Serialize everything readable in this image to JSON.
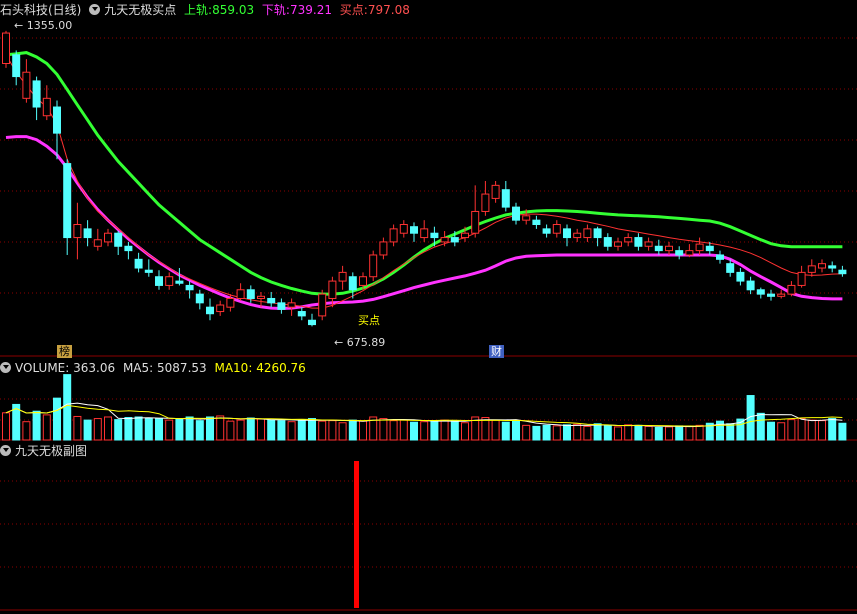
{
  "main_header": {
    "stock": "石头科技(日线)",
    "indicator": "九天无极买点",
    "upper_label": "上轨:",
    "upper_value": "859.03",
    "lower_label": "下轨:",
    "lower_value": "739.21",
    "buy_label": "买点:",
    "buy_value": "797.08"
  },
  "volume_header": {
    "label": "VOLUME:",
    "value": "363.06",
    "ma5_label": "MA5:",
    "ma5_value": "5087.53",
    "ma10_label": "MA10:",
    "ma10_value": "4260.76"
  },
  "sub_header": {
    "label": "九天无极副图"
  },
  "annotations": {
    "high_label": "1355.00",
    "low_label": "675.89",
    "buy_point_label": "买点",
    "tag_bang": "榜",
    "tag_cai": "财"
  },
  "colors": {
    "up": "#ff3232",
    "down": "#54ffff",
    "upper_band": "#33ff33",
    "lower_band": "#ff33ff",
    "ma_line": "#ff3232",
    "vol_ma5": "#ffffff",
    "vol_ma10": "#ffff00",
    "grid": "#8b0000",
    "buy_label": "#ffff00",
    "upper_label": "#33ff33",
    "lower_label": "#ff33ff",
    "buy_value": "#ff5050"
  },
  "chart_data": {
    "type": "candlestick",
    "y_range": [
      640,
      1380
    ],
    "candles": [
      [
        1280,
        1350,
        1355,
        1270
      ],
      [
        1300,
        1250,
        1310,
        1230
      ],
      [
        1200,
        1260,
        1290,
        1190
      ],
      [
        1240,
        1180,
        1250,
        1150
      ],
      [
        1160,
        1200,
        1230,
        1150
      ],
      [
        1180,
        1120,
        1195,
        1060
      ],
      [
        1050,
        880,
        1060,
        840
      ],
      [
        880,
        910,
        960,
        830
      ],
      [
        900,
        880,
        920,
        860
      ],
      [
        860,
        875,
        900,
        850
      ],
      [
        870,
        890,
        900,
        860
      ],
      [
        890,
        860,
        895,
        840
      ],
      [
        860,
        850,
        870,
        830
      ],
      [
        830,
        810,
        845,
        800
      ],
      [
        805,
        800,
        830,
        790
      ],
      [
        790,
        770,
        805,
        760
      ],
      [
        770,
        790,
        800,
        760
      ],
      [
        780,
        775,
        810,
        770
      ],
      [
        770,
        760,
        780,
        740
      ],
      [
        750,
        730,
        760,
        715
      ],
      [
        720,
        705,
        740,
        690
      ],
      [
        710,
        725,
        735,
        700
      ],
      [
        720,
        740,
        750,
        710
      ],
      [
        740,
        760,
        775,
        735
      ],
      [
        760,
        740,
        770,
        730
      ],
      [
        740,
        745,
        755,
        720
      ],
      [
        740,
        730,
        755,
        720
      ],
      [
        730,
        715,
        740,
        705
      ],
      [
        720,
        730,
        740,
        700
      ],
      [
        710,
        700,
        720,
        690
      ],
      [
        690,
        680,
        705,
        676
      ],
      [
        700,
        750,
        760,
        690
      ],
      [
        740,
        780,
        790,
        720
      ],
      [
        780,
        800,
        815,
        760
      ],
      [
        790,
        760,
        800,
        740
      ],
      [
        770,
        790,
        800,
        760
      ],
      [
        790,
        840,
        850,
        780
      ],
      [
        840,
        870,
        880,
        830
      ],
      [
        870,
        900,
        910,
        860
      ],
      [
        890,
        910,
        920,
        880
      ],
      [
        905,
        890,
        915,
        870
      ],
      [
        880,
        900,
        920,
        870
      ],
      [
        890,
        880,
        905,
        860
      ],
      [
        870,
        880,
        895,
        860
      ],
      [
        880,
        870,
        895,
        860
      ],
      [
        880,
        890,
        905,
        870
      ],
      [
        890,
        940,
        1000,
        880
      ],
      [
        940,
        980,
        1010,
        930
      ],
      [
        970,
        1000,
        1010,
        960
      ],
      [
        990,
        950,
        1010,
        940
      ],
      [
        950,
        920,
        960,
        910
      ],
      [
        920,
        930,
        945,
        910
      ],
      [
        920,
        910,
        930,
        900
      ],
      [
        900,
        890,
        910,
        880
      ],
      [
        890,
        910,
        920,
        880
      ],
      [
        900,
        880,
        910,
        860
      ],
      [
        880,
        890,
        900,
        870
      ],
      [
        880,
        900,
        910,
        870
      ],
      [
        900,
        880,
        905,
        860
      ],
      [
        880,
        860,
        890,
        850
      ],
      [
        860,
        870,
        880,
        850
      ],
      [
        870,
        880,
        890,
        860
      ],
      [
        880,
        860,
        890,
        850
      ],
      [
        860,
        870,
        880,
        850
      ],
      [
        860,
        850,
        875,
        840
      ],
      [
        850,
        860,
        870,
        840
      ],
      [
        850,
        840,
        860,
        830
      ],
      [
        840,
        850,
        865,
        835
      ],
      [
        850,
        865,
        880,
        840
      ],
      [
        860,
        850,
        870,
        840
      ],
      [
        840,
        830,
        850,
        820
      ],
      [
        820,
        800,
        830,
        790
      ],
      [
        800,
        780,
        810,
        770
      ],
      [
        780,
        760,
        790,
        750
      ],
      [
        760,
        750,
        765,
        740
      ],
      [
        750,
        745,
        760,
        735
      ],
      [
        745,
        750,
        760,
        740
      ],
      [
        750,
        770,
        780,
        745
      ],
      [
        770,
        800,
        815,
        765
      ],
      [
        800,
        815,
        830,
        790
      ],
      [
        810,
        820,
        830,
        800
      ],
      [
        815,
        810,
        825,
        800
      ],
      [
        805,
        797,
        815,
        790
      ]
    ],
    "upper_band": [
      1300,
      1302,
      1305,
      1295,
      1280,
      1255,
      1220,
      1185,
      1150,
      1115,
      1085,
      1055,
      1030,
      1005,
      980,
      955,
      935,
      915,
      895,
      875,
      860,
      845,
      830,
      815,
      800,
      788,
      778,
      770,
      763,
      757,
      752,
      750,
      750,
      752,
      757,
      764,
      773,
      785,
      800,
      817,
      835,
      852,
      866,
      878,
      888,
      898,
      908,
      917,
      925,
      932,
      936,
      939,
      941,
      942,
      942,
      941,
      940,
      938,
      936,
      934,
      932,
      931,
      930,
      929,
      928,
      926,
      924,
      922,
      920,
      918,
      913,
      905,
      895,
      885,
      875,
      866,
      861,
      859,
      859,
      859,
      859,
      859,
      859
    ],
    "lower_band": [
      1110,
      1112,
      1112,
      1105,
      1090,
      1070,
      1040,
      1005,
      972,
      944,
      920,
      898,
      877,
      858,
      840,
      823,
      808,
      794,
      782,
      770,
      760,
      750,
      741,
      733,
      726,
      721,
      718,
      717,
      718,
      721,
      725,
      728,
      730,
      731,
      732,
      734,
      738,
      744,
      751,
      758,
      765,
      771,
      777,
      782,
      787,
      792,
      798,
      805,
      815,
      826,
      833,
      837,
      838,
      839,
      840,
      840,
      840,
      840,
      840,
      840,
      840,
      840,
      840,
      840,
      840,
      840,
      840,
      840,
      840,
      840,
      838,
      830,
      818,
      803,
      790,
      778,
      765,
      752,
      745,
      742,
      740,
      739,
      739
    ],
    "ma_line": [
      1300,
      1260,
      1230,
      1200,
      1180,
      1140,
      1060,
      1010,
      970,
      940,
      920,
      900,
      880,
      860,
      840,
      825,
      810,
      795,
      785,
      775,
      765,
      756,
      748,
      742,
      737,
      733,
      730,
      727,
      725,
      722,
      718,
      718,
      724,
      735,
      746,
      758,
      772,
      788,
      804,
      819,
      834,
      847,
      858,
      866,
      873,
      880,
      890,
      902,
      915,
      925,
      931,
      934,
      934,
      932,
      929,
      925,
      920,
      916,
      911,
      906,
      900,
      896,
      892,
      888,
      884,
      880,
      876,
      873,
      870,
      867,
      863,
      858,
      852,
      844,
      834,
      822,
      810,
      800,
      795,
      793,
      794,
      796,
      797
    ],
    "volume": {
      "ma5_line": "white",
      "ma10_line": "yellow",
      "bars": [
        5200,
        6800,
        3500,
        5500,
        4800,
        8000,
        12500,
        4500,
        3800,
        4100,
        4400,
        3900,
        4300,
        4400,
        4200,
        4100,
        3800,
        4000,
        4400,
        3700,
        4400,
        4600,
        3600,
        3800,
        4200,
        4000,
        3800,
        3700,
        3500,
        3900,
        4100,
        3600,
        3700,
        3300,
        3800,
        3600,
        4400,
        4100,
        3700,
        3800,
        3400,
        3500,
        3700,
        3800,
        3600,
        3300,
        4400,
        4300,
        3800,
        3400,
        3600,
        2800,
        2600,
        2800,
        2700,
        2900,
        3000,
        2600,
        3100,
        2700,
        2500,
        2900,
        2800,
        2600,
        2400,
        2500,
        2700,
        2600,
        2800,
        3200,
        3600,
        3100,
        4000,
        8500,
        5100,
        3400,
        3300,
        3900,
        4100,
        3800,
        3700,
        4100,
        3200
      ]
    },
    "sub_indicator": {
      "signal_index": 31,
      "value": 1
    }
  }
}
